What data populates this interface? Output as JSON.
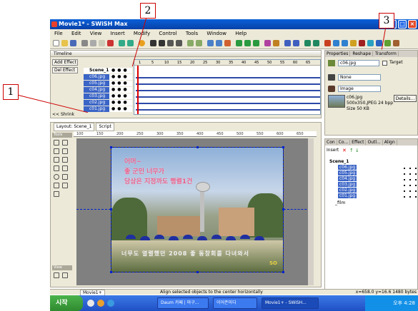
{
  "app": {
    "title": "Movie1* - SWiSH Max",
    "menu": [
      "File",
      "Edit",
      "View",
      "Insert",
      "Modify",
      "Control",
      "Tools",
      "Window",
      "Help"
    ]
  },
  "timeline": {
    "title": "Timeline",
    "add_effect": "Add Effect",
    "del_effect": "Del Effect",
    "root": "Scene_1",
    "layers": [
      "c06.jpg",
      "c05.jpg",
      "c04.jpg",
      "c03.jpg",
      "c02.jpg",
      "c01.jpg"
    ],
    "shrink": "<< Shrink",
    "frame_ticks": [
      "1",
      "5",
      "10",
      "15",
      "20",
      "25",
      "30",
      "35",
      "40",
      "45",
      "50",
      "55",
      "60",
      "65"
    ]
  },
  "layout": {
    "tabs": [
      "Layout: Scene_1",
      "Script"
    ],
    "tools_label": "Tools",
    "view_label": "View",
    "ruler_ticks": [
      "100",
      "150",
      "200",
      "250",
      "300",
      "350",
      "400",
      "450",
      "500",
      "550",
      "600",
      "650"
    ],
    "canvas_text_lines": [
      "어머~",
      "좋 군인 너무가",
      "당상은 지정까도 행렬1건"
    ],
    "canvas_bottom_text": "너무도 열렬했던 2008 좋 동창회를 다녀와서",
    "canvas_corner": "SO"
  },
  "properties": {
    "tabs": [
      "Properties",
      "Reshape",
      "Transform"
    ],
    "name": "c06.jpg",
    "target_label": "Target",
    "line_type": "None",
    "fill_type": "Image",
    "image_name": "c06.jpg",
    "image_info": "500x350,JPEG 24 bpp",
    "size": "Size 50 KB",
    "details_button": "Details..."
  },
  "outline": {
    "tabs": [
      "Con",
      "Co...",
      "Effect",
      "Outl...",
      "Align"
    ],
    "insert_label": "Insert",
    "root": "Scene_1",
    "items": [
      "c06.jpg",
      "c05.jpg",
      "c04.jpg",
      "c03.jpg",
      "c02.jpg",
      "c01.jpg"
    ],
    "film_item": "_film"
  },
  "statusbar": {
    "tab": "Movie1+",
    "message": "Align selected objects to the center horizontally",
    "coords": "x=658.0 y=16.6 1480 bytes"
  },
  "taskbar": {
    "start": "시작",
    "tasks": [
      "Daum 카페 | 마구...",
      "이어존미디",
      "Movie1+ - SWiSH..."
    ],
    "clock": "오후 4:28"
  },
  "callouts": [
    "1",
    "2",
    "3"
  ],
  "colors": {
    "selection": "#3a64c6",
    "callout": "#cc0000",
    "titlebar": "#0a5fd8"
  }
}
